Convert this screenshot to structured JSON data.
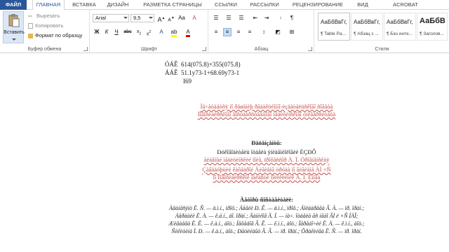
{
  "tabs": [
    "ФАЙЛ",
    "ГЛАВНАЯ",
    "ВСТАВКА",
    "ДИЗАЙН",
    "РАЗМЕТКА СТРАНИЦЫ",
    "ССЫЛКИ",
    "РАССЫЛКИ",
    "РЕЦЕНЗИРОВАНИЕ",
    "ВИД",
    "ACROBAT"
  ],
  "clipboard": {
    "paste": "Вставить",
    "cut": "Вырезать",
    "copy": "Копировать",
    "format_painter": "Формат по образцу",
    "label": "Буфер обмена"
  },
  "font": {
    "name": "Arial",
    "size": "9,5",
    "label": "Шрифт"
  },
  "paragraph": {
    "label": "Абзац"
  },
  "styles": {
    "label": "Стили",
    "items": [
      {
        "preview": "АаБбВвГг,",
        "name": "¶ Table Pa..."
      },
      {
        "preview": "АаБбВвГг,",
        "name": "¶ Абзац с ..."
      },
      {
        "preview": "АаБбВвГг,",
        "name": "¶ Без инте..."
      },
      {
        "preview": "АаБбВ",
        "name": "¶ Заголов..."
      }
    ]
  },
  "document": {
    "eq1_label": "ÓÁÊ",
    "eq1_value": "614(075.8)+355(075.8)",
    "eq2_label": "ÁÁÊ",
    "eq2_value": "51.1у73-1+68.69у73-1",
    "eq3_value": "I69",
    "title1": "Ìå÷àòàåòñÿ ïî ðåøåíèþ ðåäàêöèîííî-èçäàòåëüñêîãî ñîâåòà",
    "title2": "Íîâîñèáèðñêîãî ãîñóäàðñòâåííîãî ìåäèöèíñêîãî óíèâåðñèòåòà",
    "reviewers_head": "Ðåöåíçåíòû:",
    "rev1": "Ðóêîâîäèòåëü îòäåëà ýïèäåìèîëîãèè ÈÇÐÔ",
    "rev2": "ãëàâíûé ìåäèöèíñêèé ïîëå, ïðîôåññîð À. Ï. Óðîâíåíñêàÿ",
    "rev3": "Çàâåäóþùèé êàôåäðîé Ãèãèåíû òðóäà ïî ãèãèåíå ÀÌ ×Ñ",
    "rev4": "ïî Íîâîñèáèðñêîé îáëàñòè ïîëèêëèíèê À. Í. Èìîâà",
    "authors_head": "Àâòîðû-ñîñòàâèòåëè:",
    "auth1": "Àâàíåñÿíö Ë. Ñ. — ä.ì.í., ïðîô.; Áåãëè Ð. Ê. — ä.ì.í., ïðîô.; Áîëäàðåâà Ã. À. — ïð. îðäí.;",
    "auth2": "Áåðäàëè Ë. À. — ê.á.í., äî. îðäí.; Äàíèëîâ Ä. Í. — íà÷. îòäåëà ãñ íåáî ÂÌ ë ×Ñ ÍÀÎ;",
    "auth3": "Æèâàåâà Ë. Ê. — ê.à.í., àîö.; Íåôåäîâ Ã. Ê. — ê.ì.í., àîö.; Ïåðåáî÷èé Ë. À. — ê.ì.í., àîö.;",
    "auth4": "Ñèêèòèíà Ì. Ð. — ê.à.í., àîö.; Ðåöëéäûò Â. Ã. — ïð. îðäí.; Ôðàêèéâà Ë. Ñ. — ïð. îðäí."
  }
}
